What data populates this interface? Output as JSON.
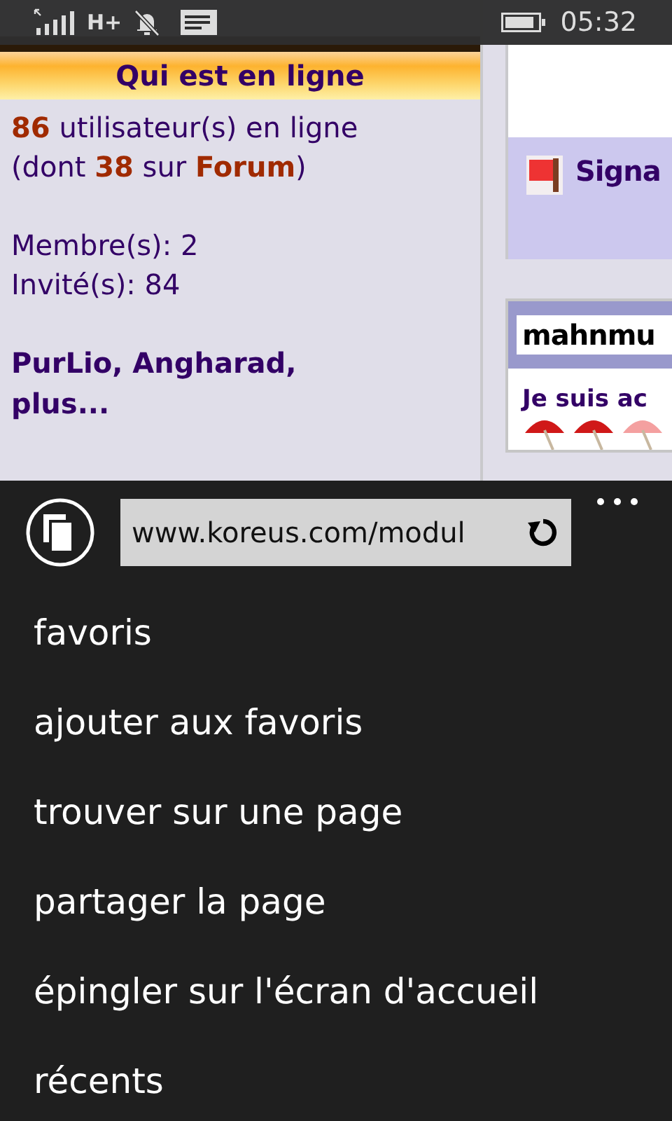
{
  "status_bar": {
    "network": "H+",
    "time": "05:32"
  },
  "page": {
    "online_box": {
      "title": "Qui est en ligne",
      "summary": "**86** utilisateur(s) en ligne (dont **38** sur **Forum**)",
      "members": "Membre(s): 2",
      "guests": "Invité(s): 84",
      "names": "**PurLio**, **Angharad**, **plus...**"
    },
    "side": {
      "report_label": "Signa",
      "user_name": "mahnmu",
      "status_text": "Je suis ac"
    }
  },
  "browser": {
    "url": "www.koreus.com/modul",
    "menu": [
      {
        "label": "favoris"
      },
      {
        "label": "ajouter aux favoris"
      },
      {
        "label": "trouver sur une page"
      },
      {
        "label": "partager la page"
      },
      {
        "label": "épingler sur l'écran d'accueil"
      },
      {
        "label": "récents"
      }
    ]
  }
}
